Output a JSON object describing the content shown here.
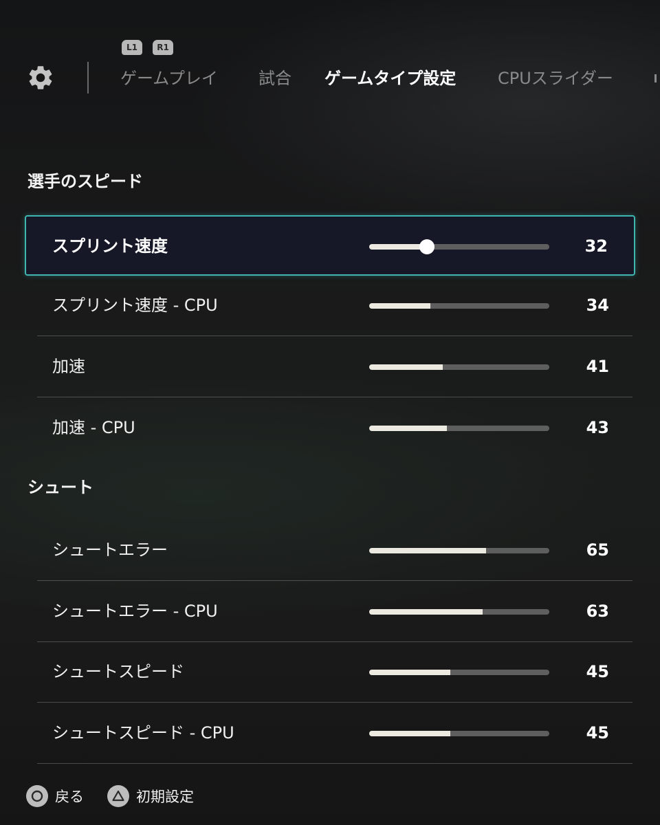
{
  "header": {
    "shoulder_left": "L1",
    "shoulder_right": "R1",
    "tabs": [
      {
        "label": "ゲームプレイ",
        "active": false
      },
      {
        "label": "試合",
        "active": false
      },
      {
        "label": "ゲームタイプ設定",
        "active": true
      },
      {
        "label": "CPUスライダー",
        "active": false
      }
    ],
    "settings_icon": "gear-icon"
  },
  "sections": [
    {
      "title": "選手のスピード",
      "rows": [
        {
          "label": "スプリント速度",
          "value": "32",
          "selected": true
        },
        {
          "label": "スプリント速度 - CPU",
          "value": "34",
          "selected": false
        },
        {
          "label": "加速",
          "value": "41",
          "selected": false
        },
        {
          "label": "加速 - CPU",
          "value": "43",
          "selected": false
        }
      ]
    },
    {
      "title": "シュート",
      "rows": [
        {
          "label": "シュートエラー",
          "value": "65",
          "selected": false
        },
        {
          "label": "シュートエラー - CPU",
          "value": "63",
          "selected": false
        },
        {
          "label": "シュートスピード",
          "value": "45",
          "selected": false
        },
        {
          "label": "シュートスピード - CPU",
          "value": "45",
          "selected": false
        }
      ]
    }
  ],
  "footer": {
    "back_label": "戻る",
    "back_icon": "circle-button-icon",
    "reset_label": "初期設定",
    "reset_icon": "triangle-button-icon"
  },
  "colors": {
    "selection_border": "#3fb7b0",
    "slider_fill": "#ece9e0",
    "slider_track": "#5e5e5e"
  }
}
